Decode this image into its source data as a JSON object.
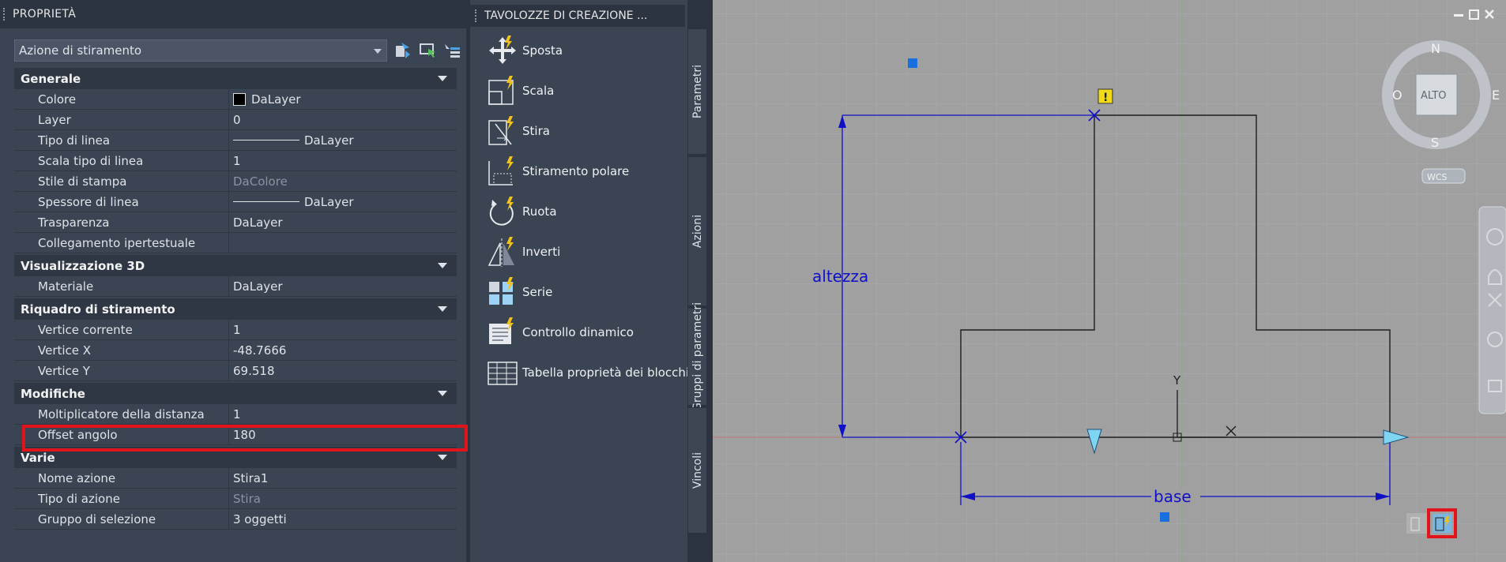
{
  "properties": {
    "title": "PROPRIETÀ",
    "selector": "Azione di stiramento",
    "categories": [
      {
        "name": "Generale",
        "rows": [
          {
            "k": "Colore",
            "v": "DaLayer"
          },
          {
            "k": "Layer",
            "v": "0"
          },
          {
            "k": "Tipo di linea",
            "v": "DaLayer"
          },
          {
            "k": "Scala tipo di linea",
            "v": "1"
          },
          {
            "k": "Stile di stampa",
            "v": "DaColore"
          },
          {
            "k": "Spessore di linea",
            "v": "DaLayer"
          },
          {
            "k": "Trasparenza",
            "v": "DaLayer"
          },
          {
            "k": "Collegamento ipertestuale",
            "v": ""
          }
        ]
      },
      {
        "name": "Visualizzazione 3D",
        "rows": [
          {
            "k": "Materiale",
            "v": "DaLayer"
          }
        ]
      },
      {
        "name": "Riquadro di stiramento",
        "rows": [
          {
            "k": "Vertice corrente",
            "v": "1"
          },
          {
            "k": "Vertice X",
            "v": "-48.7666"
          },
          {
            "k": "Vertice Y",
            "v": "69.518"
          }
        ]
      },
      {
        "name": "Modifiche",
        "rows": [
          {
            "k": "Moltiplicatore della distanza",
            "v": "1"
          },
          {
            "k": "Offset angolo",
            "v": "180"
          }
        ]
      },
      {
        "name": "Varie",
        "rows": [
          {
            "k": "Nome azione",
            "v": "Stira1"
          },
          {
            "k": "Tipo di azione",
            "v": "Stira"
          },
          {
            "k": "Gruppo di selezione",
            "v": "3 oggetti"
          }
        ]
      }
    ]
  },
  "palette": {
    "title": "TAVOLOZZE DI CREAZIONE ...",
    "tools": [
      {
        "label": "Sposta",
        "icon": "move-icon"
      },
      {
        "label": "Scala",
        "icon": "scale-icon"
      },
      {
        "label": "Stira",
        "icon": "stretch-icon"
      },
      {
        "label": "Stiramento polare",
        "icon": "polar-stretch-icon"
      },
      {
        "label": "Ruota",
        "icon": "rotate-icon"
      },
      {
        "label": "Inverti",
        "icon": "flip-icon"
      },
      {
        "label": "Serie",
        "icon": "array-icon"
      },
      {
        "label": "Controllo dinamico",
        "icon": "lookup-icon"
      },
      {
        "label": "Tabella proprietà dei blocchi",
        "icon": "block-table-icon"
      }
    ],
    "tabs": [
      "Parametri",
      "Azioni",
      "Gruppi di parametri",
      "Vincoli"
    ],
    "active_tab": "Azioni"
  },
  "drawing": {
    "dim_height": "altezza",
    "dim_base": "base",
    "ucs_y": "Y",
    "compass": {
      "n": "N",
      "s": "S",
      "e": "E",
      "w": "O",
      "center": "ALTO",
      "wcs": "WCS"
    }
  }
}
